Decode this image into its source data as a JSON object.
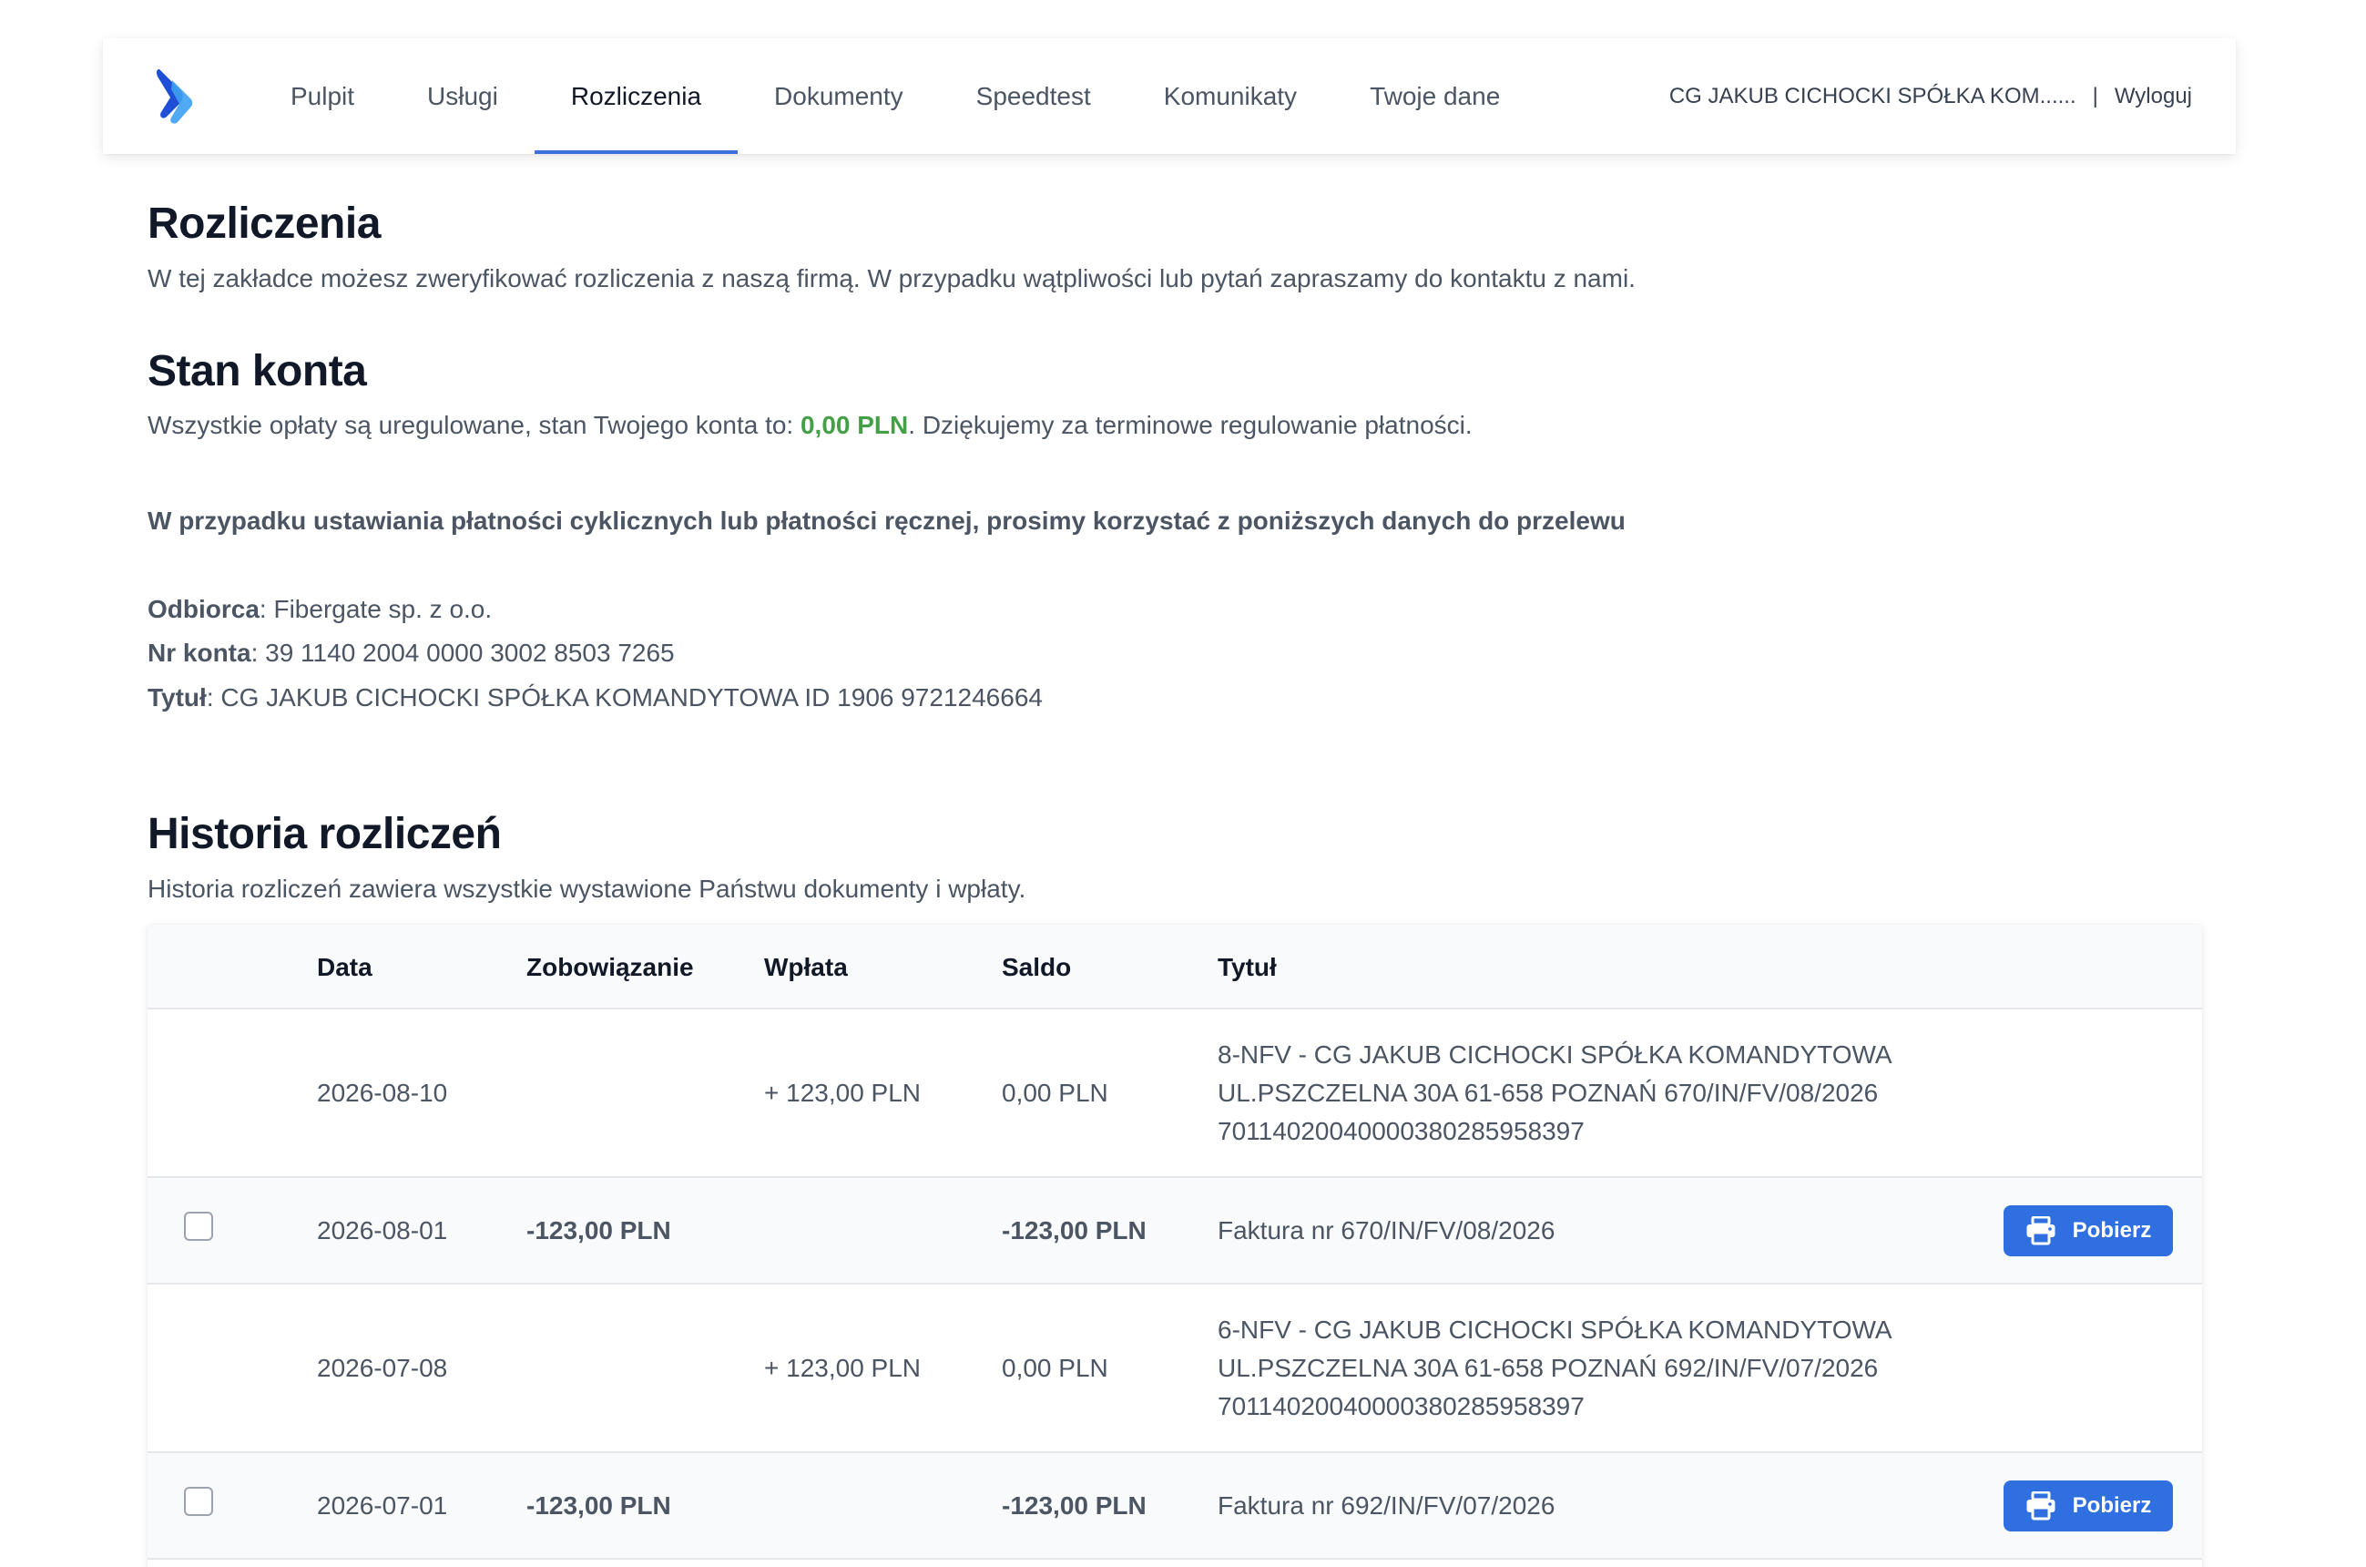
{
  "nav": {
    "items": [
      {
        "label": "Pulpit"
      },
      {
        "label": "Usługi"
      },
      {
        "label": "Rozliczenia"
      },
      {
        "label": "Dokumenty"
      },
      {
        "label": "Speedtest"
      },
      {
        "label": "Komunikaty"
      },
      {
        "label": "Twoje dane"
      }
    ],
    "active_index": 2,
    "user_name": "CG JAKUB CICHOCKI SPÓŁKA KOM......",
    "separator": "|",
    "logout": "Wyloguj"
  },
  "billing": {
    "title": "Rozliczenia",
    "intro": "W tej zakładce możesz zweryfikować rozliczenia z naszą firmą. W przypadku wątpliwości lub pytań zapraszamy do kontaktu z nami."
  },
  "account": {
    "title": "Stan konta",
    "status_before": "Wszystkie opłaty są uregulowane, stan Twojego konta to: ",
    "balance": "0,00 PLN",
    "status_after": ". Dziękujemy za terminowe regulowanie płatności.",
    "balance_color": "#43a047",
    "transfer_notice": "W przypadku ustawiania płatności cyklicznych lub płatności ręcznej, prosimy korzystać z poniższych danych do przelewu",
    "recipient_label": "Odbiorca",
    "recipient_value": ": Fibergate sp. z o.o.",
    "account_label": "Nr konta",
    "account_value": ": 39 1140 2004 0000 3002 8503 7265",
    "title_label": "Tytuł",
    "title_value": ": CG JAKUB CICHOCKI SPÓŁKA KOMANDYTOWA ID 1906 9721246664"
  },
  "history": {
    "title": "Historia rozliczeń",
    "subtitle": "Historia rozliczeń zawiera wszystkie wystawione Państwu dokumenty i wpłaty.",
    "columns": {
      "date": "Data",
      "liability": "Zobowiązanie",
      "payment": "Wpłata",
      "balance": "Saldo",
      "title": "Tytuł"
    },
    "rows": [
      {
        "date": "2026-08-10",
        "liability": "",
        "payment": "+ 123,00 PLN",
        "balance": "0,00 PLN",
        "title": "8-NFV - CG JAKUB CICHOCKI SPÓŁKA KOMANDYTOWA UL.PSZCZELNA 30A 61-658 POZNAŃ 670/IN/FV/08/2026 70114020040000380285958397"
      },
      {
        "date": "2026-08-01",
        "liability": "-123,00 PLN",
        "payment": "",
        "balance": "-123,00 PLN",
        "title": "Faktura nr 670/IN/FV/08/2026",
        "action": "Pobierz"
      },
      {
        "date": "2026-07-08",
        "liability": "",
        "payment": "+ 123,00 PLN",
        "balance": "0,00 PLN",
        "title": "6-NFV - CG JAKUB CICHOCKI SPÓŁKA KOMANDYTOWA UL.PSZCZELNA 30A 61-658 POZNAŃ 692/IN/FV/07/2026 70114020040000380285958397"
      },
      {
        "date": "2026-07-01",
        "liability": "-123,00 PLN",
        "payment": "",
        "balance": "-123,00 PLN",
        "title": "Faktura nr 692/IN/FV/07/2026",
        "action": "Pobierz"
      }
    ],
    "button_color": "#2f6fe0"
  }
}
